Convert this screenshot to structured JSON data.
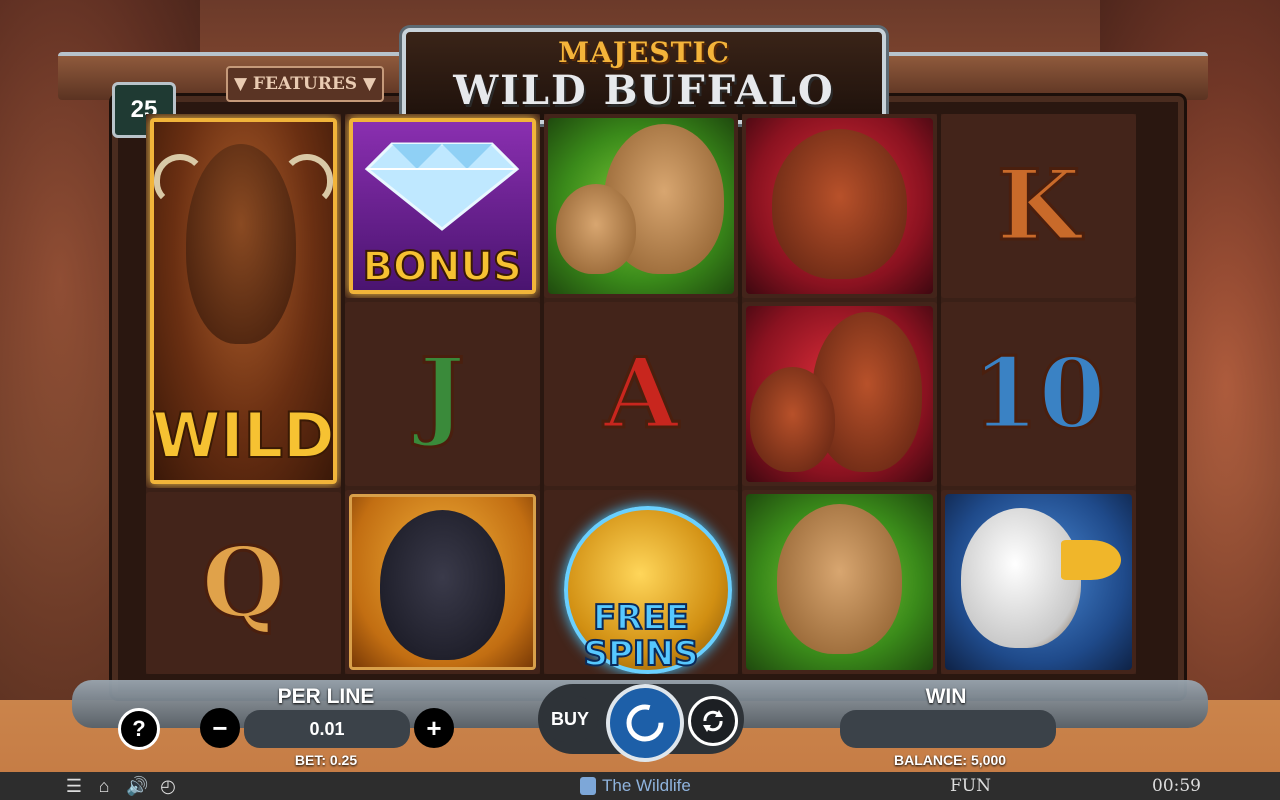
{
  "game": {
    "title_line1": "MAJESTIC",
    "title_line2": "WILD BUFFALO",
    "features_label": "▼ FEATURES ▼",
    "paylines": "25"
  },
  "reels": [
    [
      {
        "symbol": "wild-buffalo",
        "label": "WILD",
        "tall": true
      },
      {
        "symbol": "letter-q",
        "label": "Q"
      }
    ],
    [
      {
        "symbol": "bonus-diamond",
        "label": "BONUS"
      },
      {
        "symbol": "letter-j",
        "label": "J"
      },
      {
        "symbol": "bear",
        "label": ""
      }
    ],
    [
      {
        "symbol": "cougar-pair",
        "label": ""
      },
      {
        "symbol": "letter-a",
        "label": "A"
      },
      {
        "symbol": "free-spins-coin",
        "label": "FREE SPINS"
      }
    ],
    [
      {
        "symbol": "wolf",
        "label": ""
      },
      {
        "symbol": "wolf-pair",
        "label": ""
      },
      {
        "symbol": "cougar",
        "label": ""
      }
    ],
    [
      {
        "symbol": "letter-k",
        "label": "K"
      },
      {
        "symbol": "ten",
        "label": "10"
      },
      {
        "symbol": "eagle",
        "label": ""
      }
    ]
  ],
  "controls": {
    "help_label": "?",
    "per_line_label": "PER LINE",
    "per_line_value": "0.01",
    "minus_label": "−",
    "plus_label": "+",
    "bet_text": "BET: 0.25",
    "buy_label": "BUY",
    "win_label": "WIN",
    "win_value": "",
    "balance_text": "BALANCE: 5,000"
  },
  "bottom_bar": {
    "brand": "The Wildlife",
    "mode": "FUN",
    "clock": "00:59"
  },
  "colors": {
    "gold": "#f1b43a",
    "letter_q": "#e0a24a",
    "letter_j": "#3a8a3a",
    "letter_a": "#c8261e",
    "letter_k": "#c96a2a",
    "letter_ten": "#3a82c4"
  }
}
